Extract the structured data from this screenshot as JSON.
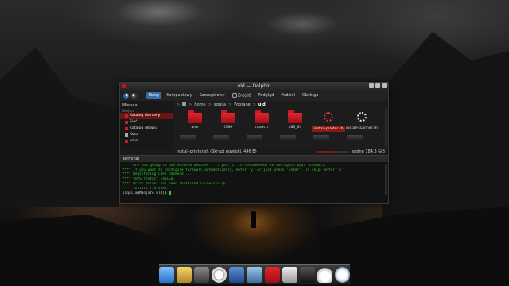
{
  "window": {
    "title": "uld — Dolphin",
    "toolbar": {
      "back": "◀",
      "forward": "▶",
      "buttons": [
        "Ikony",
        "Kompaktowy",
        "Szczegółowy",
        "Znajdź",
        "Podgląd",
        "Podziel",
        "Obsługa"
      ]
    },
    "places": {
      "header": "Miejsca",
      "subheader": "Miejsca",
      "items": [
        {
          "label": "Katalog domowy",
          "icon": "home-folder-icon"
        },
        {
          "label": "Sieć",
          "icon": "network-icon"
        },
        {
          "label": "Katalog główny",
          "icon": "root-folder-icon"
        },
        {
          "label": "Kosz",
          "icon": "trash-icon"
        },
        {
          "label": "wine",
          "icon": "wine-folder-icon"
        }
      ]
    },
    "breadcrumb": [
      "home",
      "aquila",
      "Pobrane",
      "uld"
    ],
    "files": [
      {
        "name": "arm",
        "type": "folder"
      },
      {
        "name": "i386",
        "type": "folder"
      },
      {
        "name": "noarch",
        "type": "folder"
      },
      {
        "name": "x86_64",
        "type": "folder"
      },
      {
        "name": "install-printer.sh",
        "type": "script"
      },
      {
        "name": "install-scanner.sh",
        "type": "script"
      }
    ],
    "status": {
      "text": "install-printer.sh (Skrypt powłoki, 446 B)",
      "free": "wolne 184,3 GiB",
      "usage_fraction": 0.55
    },
    "terminal": {
      "header": "Terminal",
      "lines": [
        "**** Are you going to use network devices ? If yes, it is recommended to configure your firewall.",
        "**** If you want to configure firewall automatically, enter 'y' or just press 'Enter'. To skip, enter 'n'.",
        "",
        "**** Registering CUPS backend ...",
        "**** CUPS restart FAILED.",
        "**** Print driver has been installed successfully.",
        "**** Install finished."
      ],
      "prompt": "[aquila@Manjaro uld]$ "
    }
  },
  "dock": [
    "finder-icon",
    "stamp-app-icon",
    "storage-icon",
    "clock-icon",
    "tools-icon",
    "image-viewer-icon",
    "red-folder-icon",
    "text-editor-icon",
    "terminal-icon",
    "cloud-icon",
    "safari-icon"
  ],
  "colors": {
    "accent": "#c21f2a",
    "terminal_text": "#28c628",
    "selection": "#3b6ea8"
  }
}
